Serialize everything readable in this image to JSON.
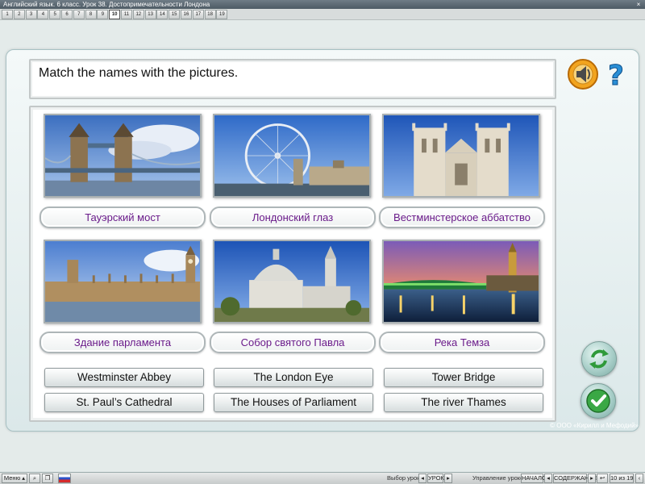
{
  "window": {
    "title": "Английский язык. 6 класс. Урок 38. Достопримечательности Лондона",
    "close_glyph": "×"
  },
  "lesson_tabs": [
    "1",
    "2",
    "3",
    "4",
    "5",
    "6",
    "7",
    "8",
    "9",
    "10",
    "11",
    "12",
    "13",
    "14",
    "15",
    "16",
    "17",
    "18",
    "19"
  ],
  "lesson_tabs_active": "10",
  "task": {
    "instruction": "Match the names with the pictures."
  },
  "tools": {
    "sound_icon": "speaker-icon",
    "help_icon": "question-icon",
    "help_glyph": "?"
  },
  "photos": [
    {
      "subject": "tower-bridge"
    },
    {
      "subject": "london-eye"
    },
    {
      "subject": "westminster-abbey"
    },
    {
      "subject": "houses-of-parliament"
    },
    {
      "subject": "st-pauls-cathedral"
    },
    {
      "subject": "river-thames-night"
    }
  ],
  "ru_labels": [
    "Тауэрский мост",
    "Лондонский глаз",
    "Вестминстерское аббатство",
    "Здание парламента",
    "Собор святого Павла",
    "Река Темза"
  ],
  "en_options": [
    "Westminster Abbey",
    "The London Eye",
    "Tower Bridge",
    "St. Paul’s Cathedral",
    "The Houses of Parliament",
    "The river Thames"
  ],
  "actions": {
    "reset_icon": "refresh-icon",
    "check_icon": "checkmark-icon"
  },
  "copyright": "© ООО «Кирилл и Мефодий»",
  "bottom": {
    "menu_label": "Меню",
    "lesson_select_label": "Выбор урока:",
    "lesson_select_value": "УРОК",
    "lesson_control_label": "Управление уроком:",
    "start_label": "НАЧАЛО",
    "contents_label": "СОДЕРЖАНИЕ",
    "page_counter": "10 из 19"
  },
  "colors": {
    "ru_label_text": "#6a1b8a",
    "panel_bg": "#e4ebea",
    "action_green": "#2f9a3a"
  }
}
